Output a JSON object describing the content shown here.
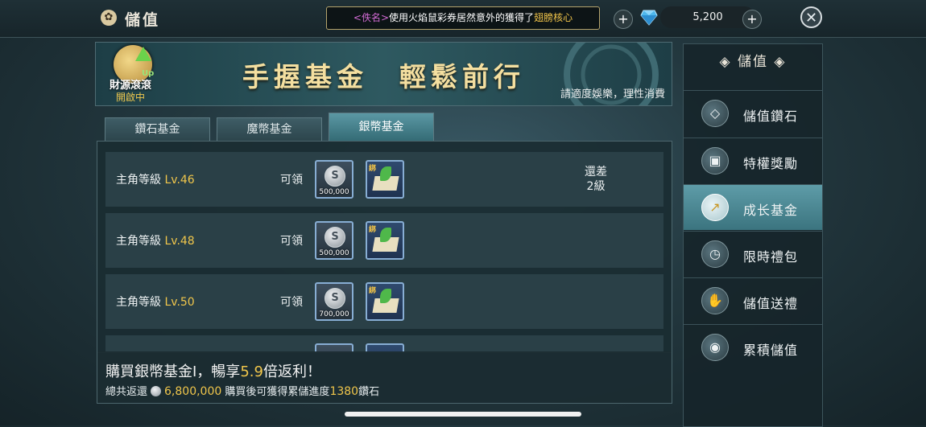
{
  "topbar": {
    "title": "儲值",
    "marquee": {
      "name": "<佚名>",
      "text": "使用火焰鼠彩券居然意外的獲得了",
      "item": "翅膀核心"
    },
    "diamond_amount": "5,200",
    "plus": "+"
  },
  "banner": {
    "heading": "手握基金　輕鬆前行",
    "note": "請適度娛樂，理性消費",
    "badge_title": "財源滾滾",
    "badge_status": "開啟中",
    "badge_up": "Up"
  },
  "tabs": [
    {
      "label": "鑽石基金",
      "active": false
    },
    {
      "label": "魔幣基金",
      "active": false
    },
    {
      "label": "銀幣基金",
      "active": true
    }
  ],
  "rows": [
    {
      "label": "主角等級",
      "level": "Lv.46",
      "claim": "可領",
      "coin_amount": "500,000",
      "bound": "綁",
      "note_line1": "還差",
      "note_line2": "2級"
    },
    {
      "label": "主角等級",
      "level": "Lv.48",
      "claim": "可領",
      "coin_amount": "500,000",
      "bound": "綁",
      "note_line1": "",
      "note_line2": ""
    },
    {
      "label": "主角等級",
      "level": "Lv.50",
      "claim": "可領",
      "coin_amount": "700,000",
      "bound": "綁",
      "note_line1": "",
      "note_line2": ""
    }
  ],
  "footer": {
    "main_prefix": "購買銀幣基金Ⅰ，暢享",
    "multiplier": "5.9",
    "main_suffix": "倍返利！",
    "total_label": "總共返還",
    "total_amount": "6,800,000",
    "progress_prefix": "購買後可獲得累儲進度",
    "progress_amount": "1380",
    "progress_unit": "鑽石"
  },
  "sidebar": {
    "header": "儲值",
    "items": [
      {
        "label": "儲值鑽石",
        "icon": "diamond-icon",
        "glyph": "◇",
        "active": false
      },
      {
        "label": "特權獎勵",
        "icon": "chest-icon",
        "glyph": "▣",
        "active": false
      },
      {
        "label": "成长基金",
        "icon": "growth-arrow-icon",
        "glyph": "↗",
        "active": true
      },
      {
        "label": "限時禮包",
        "icon": "gift-timer-icon",
        "glyph": "◷",
        "active": false
      },
      {
        "label": "儲值送禮",
        "icon": "gift-hand-icon",
        "glyph": "✋",
        "active": false
      },
      {
        "label": "累積儲值",
        "icon": "piggy-bank-icon",
        "glyph": "◉",
        "active": false
      }
    ]
  },
  "colors": {
    "accent_gold": "#f0c64b",
    "active_tab": "#4f8b96",
    "marquee_name": "#d36bd5"
  }
}
